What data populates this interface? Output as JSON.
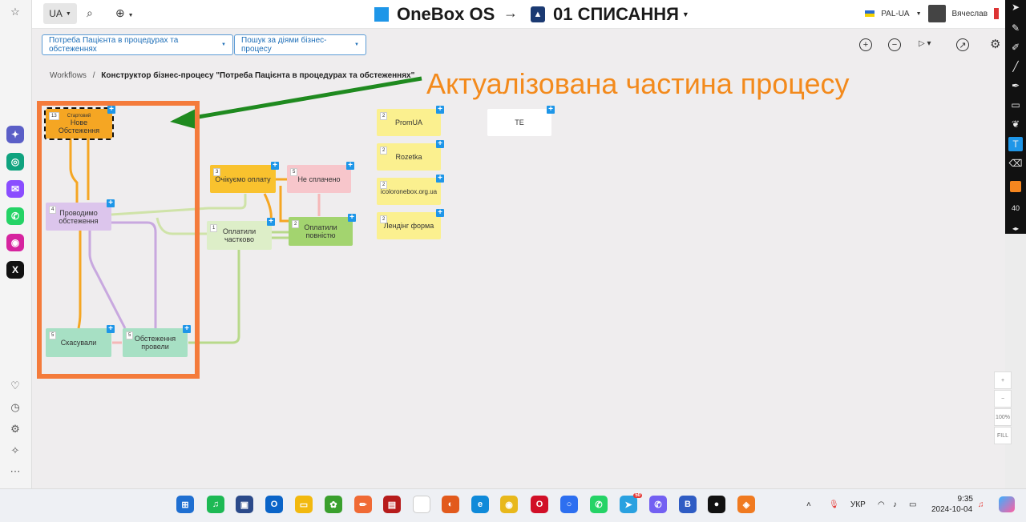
{
  "topbar": {
    "lang": "UA",
    "brand": "OneBox OS",
    "arrow": "→",
    "process": "01 СПИСАННЯ",
    "company": "PAL-UA",
    "user": "Вячеслав"
  },
  "filters": {
    "workflow": "Потреба Пацієнта в процедурах та обстеженнях",
    "search": "Пошук за діями бізнес-процесу"
  },
  "breadcrumb": {
    "root": "Workflows",
    "sep": "/",
    "current": "Конструктор бізнес-процесу \"Потреба Пацієнта в процедурах та обстеженнях\""
  },
  "annotation": "Актуалізована частина процесу",
  "nodes": [
    {
      "count": "13",
      "sub": "Стартовий",
      "label": "Нове Обстеження"
    },
    {
      "count": "4",
      "label": "Проводимо обстеження"
    },
    {
      "count": "5",
      "label": "Скасували"
    },
    {
      "count": "5",
      "label": "Обстеження провели"
    },
    {
      "count": "3",
      "label": "Очікуємо оплату"
    },
    {
      "count": "5",
      "label": "Не сплачено"
    },
    {
      "count": "1",
      "label": "Оплатили частково"
    },
    {
      "count": "2",
      "label": "Оплатили повністю"
    },
    {
      "count": "2",
      "label": "PromUA"
    },
    {
      "count": "2",
      "label": "Rozetka"
    },
    {
      "count": "2",
      "label": "icoloronebox.org.ua"
    },
    {
      "count": "2",
      "label": "Лендінг форма"
    },
    {
      "count": "",
      "label": "TE"
    }
  ],
  "toolbar_size": "40",
  "zoom": {
    "plus": "+",
    "minus": "−",
    "full": "100%",
    "fill": "FILL"
  },
  "tray": {
    "lang": "УКР",
    "time": "9:35",
    "date": "2024-10-04",
    "badge": "50"
  },
  "colors": {
    "accent": "#f38a1c",
    "frame": "#f47b3b",
    "arrow": "#1f8a1f",
    "brand": "#1e96e8"
  }
}
